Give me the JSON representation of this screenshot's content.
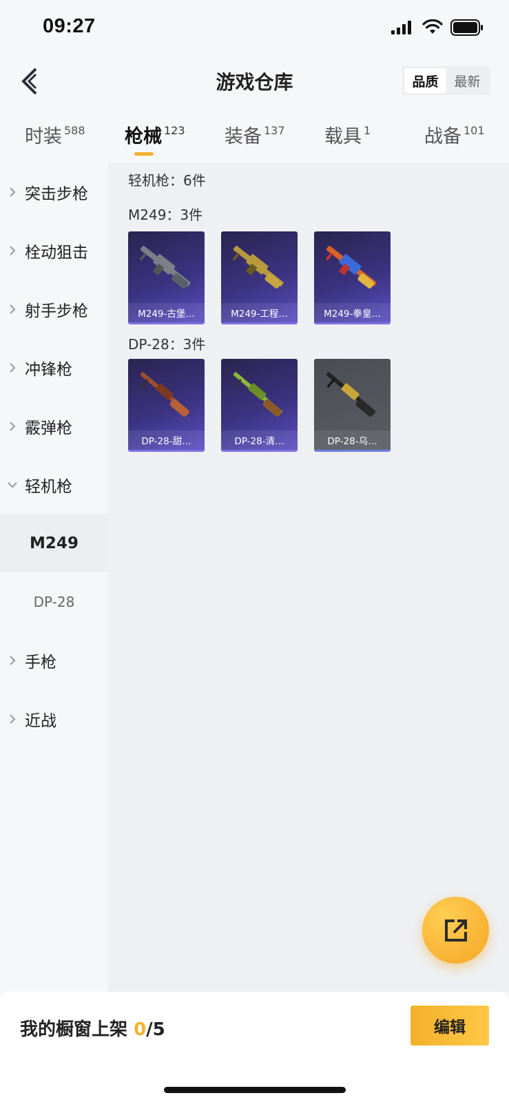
{
  "status": {
    "time": "09:27"
  },
  "header": {
    "title": "游戏仓库",
    "sort": [
      {
        "label": "品质",
        "active": true
      },
      {
        "label": "最新",
        "active": false
      }
    ]
  },
  "tabs": [
    {
      "label": "时装",
      "count": "588",
      "active": false
    },
    {
      "label": "枪械",
      "count": "123",
      "active": true
    },
    {
      "label": "装备",
      "count": "137",
      "active": false
    },
    {
      "label": "载具",
      "count": "1",
      "active": false
    },
    {
      "label": "战备",
      "count": "101",
      "active": false
    }
  ],
  "sidebar": {
    "categories": [
      {
        "label": "突击步枪",
        "expanded": false
      },
      {
        "label": "栓动狙击",
        "expanded": false
      },
      {
        "label": "射手步枪",
        "expanded": false
      },
      {
        "label": "冲锋枪",
        "expanded": false
      },
      {
        "label": "霰弹枪",
        "expanded": false
      },
      {
        "label": "轻机枪",
        "expanded": true
      },
      {
        "label": "手枪",
        "expanded": false
      },
      {
        "label": "近战",
        "expanded": false
      }
    ],
    "subitems": [
      {
        "label": "M249",
        "active": true
      },
      {
        "label": "DP-28",
        "active": false
      }
    ]
  },
  "content": {
    "category_heading": "轻机枪：6件",
    "groups": [
      {
        "heading": "M249：3件",
        "items": [
          {
            "name": "M249-古堡…",
            "gun_color": "#7a7f8a"
          },
          {
            "name": "M249-工程…",
            "gun_color": "#b79a3c"
          },
          {
            "name": "M249-拳皇…",
            "gun_color": "#d9622b"
          }
        ]
      },
      {
        "heading": "DP-28：3件",
        "items": [
          {
            "name": "DP-28-甜…",
            "gun_color": "#a0502e"
          },
          {
            "name": "DP-28-清…",
            "gun_color": "#8cb83a"
          },
          {
            "name": "DP-28-乌…",
            "gun_color": "#c9a63a"
          }
        ]
      }
    ]
  },
  "fab": {
    "icon": "share-external-icon"
  },
  "bottom": {
    "showcase_label": "我的橱窗上架",
    "current": "0",
    "max": "/5",
    "edit_label": "编辑"
  },
  "colors": {
    "accent": "#f3b12b",
    "card_purple": "#3b3380",
    "card_gray": "#55585f"
  }
}
